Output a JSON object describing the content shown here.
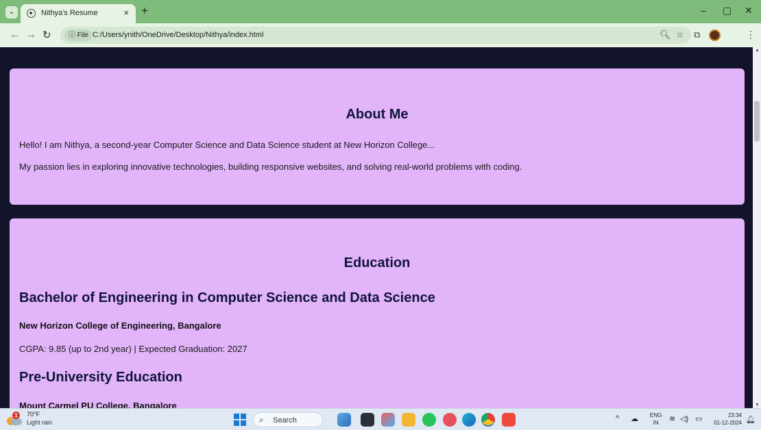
{
  "browser": {
    "tab_title": "Nithya's Resume",
    "tab_close": "×",
    "new_tab": "+",
    "file_chip": "ⓘ File",
    "url": "C:/Users/ynith/OneDrive/Desktop/Nithya/index.html",
    "window_controls": [
      "–",
      "▢",
      "✕"
    ]
  },
  "about": {
    "heading": "About Me",
    "paragraphs": [
      "Hello! I am Nithya, a second-year Computer Science and Data Science student at New Horizon College...",
      "My passion lies in exploring innovative technologies, building responsive websites, and solving real-world problems with coding."
    ]
  },
  "education": {
    "heading": "Education",
    "degree": {
      "title": "Bachelor of Engineering in Computer Science and Data Science",
      "institution": "New Horizon College of Engineering, Bangalore",
      "details": "CGPA: 9.85 (up to 2nd year) | Expected Graduation: 2027"
    },
    "pre_university": {
      "title": "Pre-University Education",
      "institution": "Mount Carmel PU College, Bangalore"
    }
  },
  "taskbar": {
    "weather_badge": "1",
    "weather_temp": "70°F",
    "weather_desc": "Light rain",
    "search_label": "Search",
    "lang_line1": "ENG",
    "lang_line2": "IN",
    "time": "23:34",
    "date": "01-12-2024"
  },
  "colors": {
    "page_background": "#12142c",
    "card_background": "#e2b4fa",
    "heading_color": "#10143a",
    "browser_frame": "#7fbc7b"
  }
}
